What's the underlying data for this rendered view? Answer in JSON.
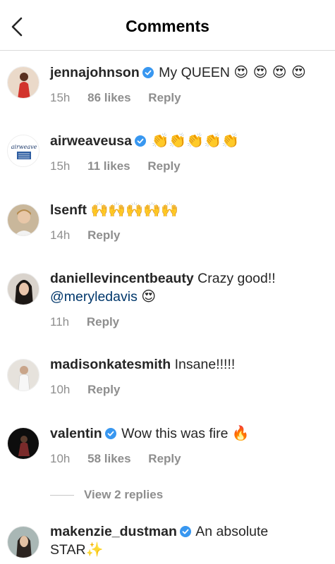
{
  "header": {
    "title": "Comments",
    "back_icon": "chevron-left-icon"
  },
  "comments": [
    {
      "username": "jennajohnson",
      "verified": true,
      "text": "My QUEEN",
      "emoji": "😍 😍 😍 😍",
      "time": "15h",
      "likes": "86 likes",
      "reply": "Reply"
    },
    {
      "username": "airweaveusa",
      "verified": true,
      "text": "",
      "emoji": "👏👏👏👏👏",
      "time": "15h",
      "likes": "11 likes",
      "reply": "Reply",
      "avatar_text": "airweave"
    },
    {
      "username": "lsenft",
      "verified": false,
      "text": "",
      "emoji": "🙌🙌🙌🙌🙌",
      "time": "14h",
      "reply": "Reply"
    },
    {
      "username": "daniellevincentbeauty",
      "verified": false,
      "text": "Crazy good!!",
      "mention": "@meryledavis",
      "emoji": "😍",
      "time": "11h",
      "reply": "Reply"
    },
    {
      "username": "madisonkatesmith",
      "verified": false,
      "text": "Insane!!!!!",
      "time": "10h",
      "reply": "Reply"
    },
    {
      "username": "valentin",
      "verified": true,
      "text": "Wow this was fire",
      "emoji": "🔥",
      "time": "10h",
      "likes": "58 likes",
      "reply": "Reply"
    },
    {
      "username": "makenzie_dustman",
      "verified": true,
      "text": "An absolute",
      "text2": "STAR",
      "emoji": "✨"
    }
  ],
  "view_replies": "View 2 replies",
  "colors": {
    "verified": "#3897f0",
    "meta": "#8e8e8e",
    "mention": "#00376b",
    "divider": "#dbdbdb"
  }
}
